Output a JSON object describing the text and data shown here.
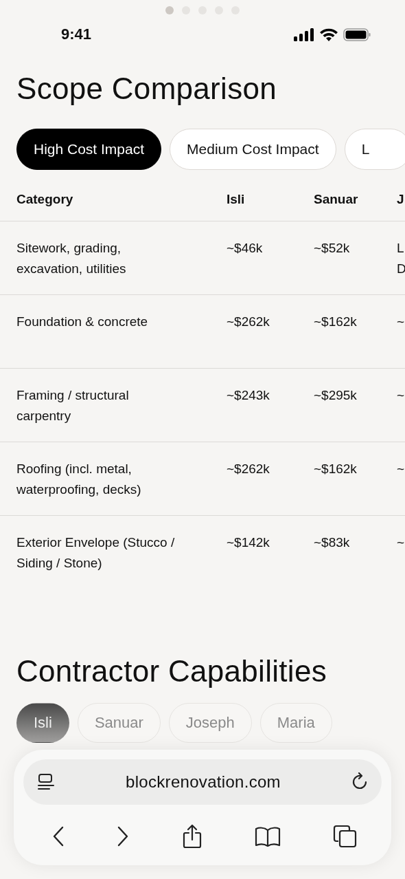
{
  "page_dots": [
    {
      "selected": true
    },
    {
      "selected": false
    },
    {
      "selected": false
    },
    {
      "selected": false
    },
    {
      "selected": false
    }
  ],
  "status_bar": {
    "time": "9:41"
  },
  "title": "Scope Comparison",
  "tabs": [
    {
      "label": "High Cost Impact",
      "selected": true
    },
    {
      "label": "Medium Cost Impact",
      "selected": false
    },
    {
      "label": "L",
      "selected": false
    }
  ],
  "table": {
    "columns": [
      "Category",
      "Isli",
      "Sanuar",
      "J"
    ],
    "rows": [
      [
        "Sitework, grading, excavation, utilities",
        "~$46k",
        "~$52k",
        "L D"
      ],
      [
        "Foundation & concrete",
        "~$262k",
        "~$162k",
        "~"
      ],
      [
        "Framing / structural carpentry",
        "~$243k",
        "~$295k",
        "~"
      ],
      [
        "Roofing (incl. metal, waterproofing, decks)",
        "~$262k",
        "~$162k",
        "~"
      ],
      [
        "Exterior Envelope (Stucco / Siding / Stone)",
        "~$142k",
        "~$83k",
        "~"
      ]
    ]
  },
  "section_title": "Contractor Capabilities",
  "contractors": [
    {
      "label": "Isli",
      "selected": true
    },
    {
      "label": "Sanuar",
      "selected": false
    },
    {
      "label": "Joseph",
      "selected": false
    },
    {
      "label": "Maria",
      "selected": false
    }
  ],
  "browser": {
    "url": "blockrenovation.com"
  }
}
